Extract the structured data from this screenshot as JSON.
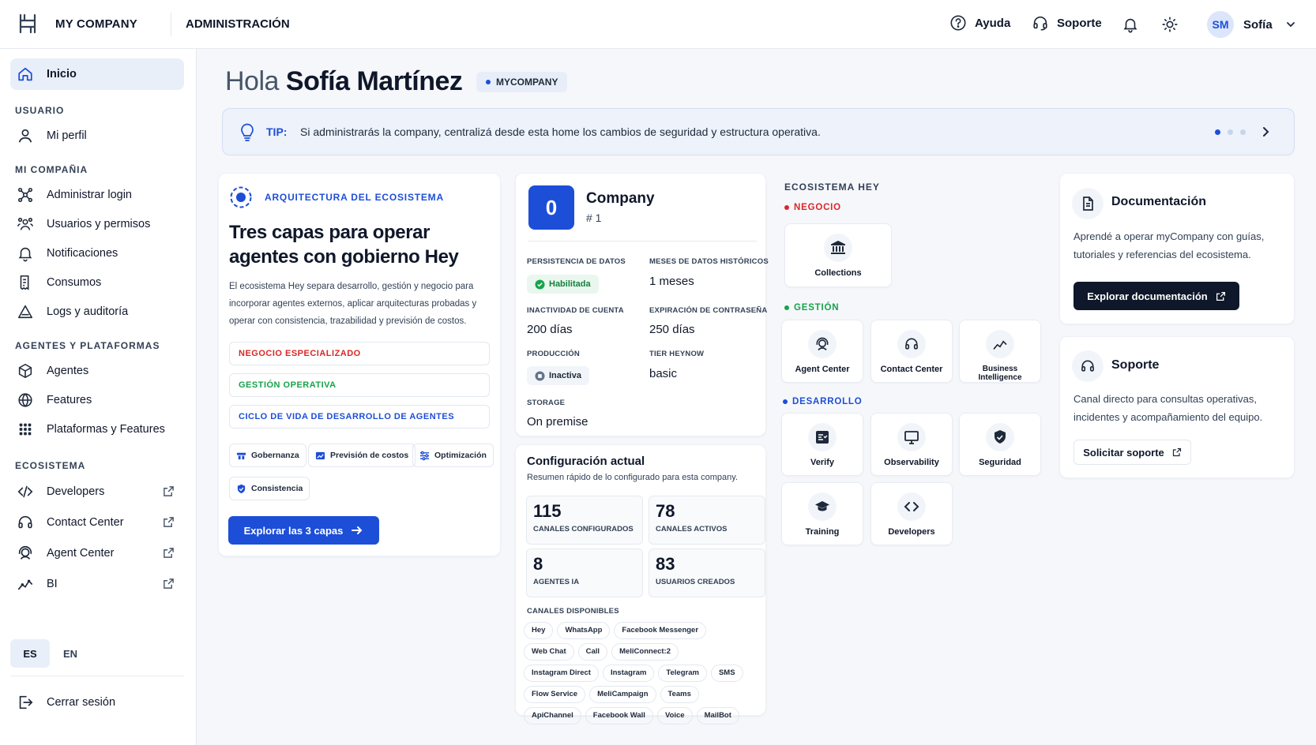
{
  "topbar": {
    "brand": "MY COMPANY",
    "section": "ADMINISTRACIÓN",
    "help_label": "Ayuda",
    "support_label": "Soporte",
    "avatar_initials": "SM",
    "user_name": "Sofía"
  },
  "sidebar": {
    "home_label": "Inicio",
    "head_user": "USUARIO",
    "profile_label": "Mi perfil",
    "head_company": "MI COMPAÑIA",
    "company_items": [
      "Administrar login",
      "Usuarios y permisos",
      "Notificaciones",
      "Consumos",
      "Logs y auditoría"
    ],
    "head_agents": "AGENTES Y PLATAFORMAS",
    "agent_items": [
      "Agentes",
      "Features",
      "Plataformas y Features"
    ],
    "head_eco": "ECOSISTEMA",
    "eco_items": [
      "Developers",
      "Contact Center",
      "Agent Center",
      "BI"
    ],
    "lang_es": "ES",
    "lang_en": "EN",
    "logout_label": "Cerrar sesión"
  },
  "greeting": {
    "hello": "Hola",
    "name": "Sofía Martínez",
    "badge": "MYCOMPANY"
  },
  "tip": {
    "label": "TIP:",
    "text": "Si administrarás la company, centralizá desde esta home los cambios de seguridad y estructura operativa.",
    "pages_total": 3,
    "page_current": 1
  },
  "architecture": {
    "eyebrow": "ARQUITECTURA DEL ECOSISTEMA",
    "title": "Tres capas para operar agentes con gobierno Hey",
    "description": "El ecosistema Hey separa desarrollo, gestión y negocio para incorporar agentes externos, aplicar arquitecturas probadas y operar con consistencia, trazabilidad y previsión de costos.",
    "layers": [
      "NEGOCIO ESPECIALIZADO",
      "GESTIÓN OPERATIVA",
      "CICLO DE VIDA DE DESARROLLO DE AGENTES"
    ],
    "tags": [
      "Gobernanza",
      "Previsión de costos",
      "Optimización",
      "Consistencia"
    ],
    "cta": "Explorar las 3 capas"
  },
  "company": {
    "avatar": "0",
    "name": "Company",
    "number": "# 1",
    "fields": {
      "persistence_label": "PERSISTENCIA DE DATOS",
      "persistence_value": "Habilitada",
      "months_label": "MESES DE DATOS HISTÓRICOS",
      "months_value": "1 meses",
      "inactivity_label": "INACTIVIDAD DE CUENTA",
      "inactivity_value": "200 días",
      "expiry_label": "EXPIRACIÓN DE CONTRASEÑA",
      "expiry_value": "250 días",
      "production_label": "PRODUCCIÓN",
      "production_value": "Inactiva",
      "tier_label": "TIER HEYNOW",
      "tier_value": "basic",
      "storage_label": "STORAGE",
      "storage_value": "On premise"
    }
  },
  "config": {
    "title": "Configuración actual",
    "subtitle": "Resumen rápido de lo configurado para esta company.",
    "stats": [
      {
        "value": "115",
        "label": "CANALES CONFIGURADOS"
      },
      {
        "value": "78",
        "label": "CANALES ACTIVOS"
      },
      {
        "value": "8",
        "label": "AGENTES IA"
      },
      {
        "value": "83",
        "label": "USUARIOS CREADOS"
      }
    ],
    "channels_label": "CANALES DISPONIBLES",
    "channels": [
      "Hey",
      "WhatsApp",
      "Facebook Messenger",
      "Web Chat",
      "Call",
      "MeliConnect:2",
      "Instagram Direct",
      "Instagram",
      "Telegram",
      "SMS",
      "Flow Service",
      "MeliCampaign",
      "Teams",
      "ApiChannel",
      "Facebook Wall",
      "Voice",
      "MailBot"
    ]
  },
  "ecosystem": {
    "title": "ECOSISTEMA HEY",
    "business_label": "NEGOCIO",
    "business": [
      "Collections"
    ],
    "management_label": "GESTIÓN",
    "management": [
      "Agent Center",
      "Contact Center",
      "Business Intelligence"
    ],
    "dev_label": "DESARROLLO",
    "dev": [
      "Verify",
      "Observability",
      "Seguridad",
      "Training",
      "Developers"
    ]
  },
  "docs": {
    "title": "Documentación",
    "text": "Aprendé a operar myCompany con guías, tutoriales y referencias del ecosistema.",
    "button": "Explorar documentación"
  },
  "support": {
    "title": "Soporte",
    "text": "Canal directo para consultas operativas, incidentes y acompañamiento del equipo.",
    "button": "Solicitar soporte"
  },
  "colors": {
    "primary": "#1d4ed8",
    "negocio": "#dc2626",
    "gestion": "#16a34a",
    "desarrollo": "#1d4ed8",
    "dark_button": "#0f172a"
  }
}
